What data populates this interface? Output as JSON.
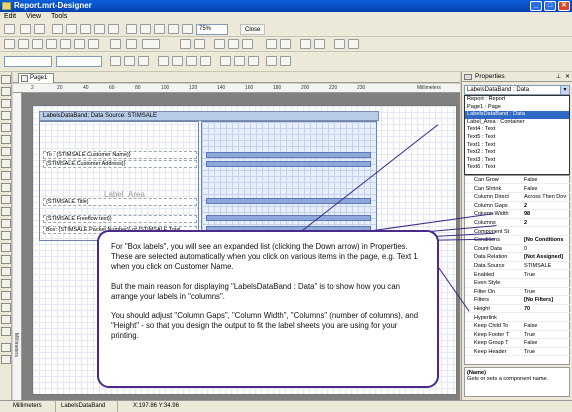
{
  "window": {
    "title": "Report.mrt-Designer",
    "buttons": [
      "_",
      "□",
      "✕"
    ]
  },
  "menu": [
    "Edit",
    "View",
    "Tools"
  ],
  "toolbar": {
    "zoom": "75%",
    "close_label": "Close"
  },
  "document_tab": "Page1",
  "ruler": {
    "ticks": [
      "2",
      "20",
      "40",
      "60",
      "80",
      "100",
      "120",
      "140",
      "160",
      "180",
      "200",
      "220",
      "230"
    ],
    "units": "Millimeters"
  },
  "band": {
    "header": "LabelsDataBand; Data Source: STIMSALE",
    "fields": [
      "To : {STIMSALE.Customer Name}}",
      "{STIMSALE.Customer Address}}",
      "{STIMSALE.Title}",
      "{STIMSALE.Freeflow text}}",
      "Box: {STIMSALE.Packet Number}} of {STIMSALE.Total"
    ],
    "label_area": "Label_Area"
  },
  "properties": {
    "title": "Properties",
    "combo_value": "LabelsDataBand : Data",
    "dropdown": [
      "Report : Report",
      "Page1 : Page",
      "LabelsDataBand : Data",
      "Label_Area : Container",
      "Text4 : Text",
      "Text5 : Text",
      "Text1 : Text",
      "Text2 : Text",
      "Text3 : Text",
      "Text6 : Text"
    ],
    "dropdown_selected": 2,
    "rows": [
      {
        "k": "Can Grow",
        "v": "False"
      },
      {
        "k": "Can Shrink",
        "v": "False"
      },
      {
        "k": "Column Direct",
        "v": "Across Then Dov"
      },
      {
        "k": "Column Gaps",
        "v": "2"
      },
      {
        "k": "Column Width",
        "v": "98"
      },
      {
        "k": "Columns",
        "v": "2"
      },
      {
        "k": "Component St",
        "v": ""
      },
      {
        "k": "Conditions",
        "v": "[No Conditions"
      },
      {
        "k": "Count Data",
        "v": "0"
      },
      {
        "k": "Data Relation",
        "v": "[Not Assigned]"
      },
      {
        "k": "Data Source",
        "v": "STIMSALE"
      },
      {
        "k": "Enabled",
        "v": "True"
      },
      {
        "k": "Even Style",
        "v": ""
      },
      {
        "k": "Filter On",
        "v": "True"
      },
      {
        "k": "Filters",
        "v": "[No Filters]"
      },
      {
        "k": "Height",
        "v": "70"
      },
      {
        "k": "Hyperlink",
        "v": ""
      },
      {
        "k": "Keep Child To",
        "v": "False"
      },
      {
        "k": "Keep Footer T",
        "v": "True"
      },
      {
        "k": "Keep Group T",
        "v": "False"
      },
      {
        "k": "Keep Header",
        "v": "True"
      }
    ],
    "desc_title": "(Name)",
    "desc_text": "Gets or sets a component name."
  },
  "statusbar": {
    "units": "Millimeters",
    "component": "LabelsDataBand",
    "coords": "X:197.86 Y:34.96"
  },
  "callout": {
    "p1": "For \"Box labels\", you will see an expanded list (clicking the Down arrow) in Properties. These are selected automatically when you click on various items in the page, e.g. Text 1 when you click on Customer Name.",
    "p2": "But the main reason for displaying \"LabelsDataBand : Data\" is to show how you can arrange your labels in \"columns\".",
    "p3": "You should adjust \"Column Gaps\", \"Column Width\", \"Columns\" (number of columns), and \"Height\" - so that you design the output to fit the label sheets you are using for your printing."
  }
}
